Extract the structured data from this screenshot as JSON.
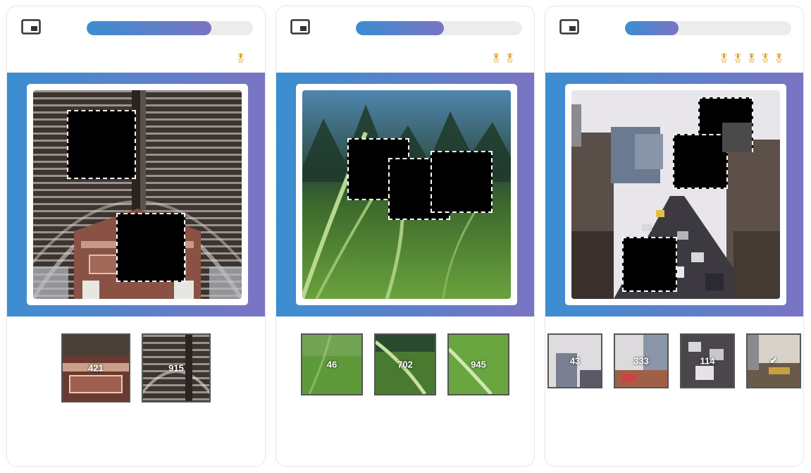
{
  "colors": {
    "accent_left": "#3b8ed0",
    "accent_right": "#7a74c4",
    "medal": "#d8a21a",
    "hole_border": "#ffffff"
  },
  "icons": {
    "picture_in_picture": "picture-in-picture-icon",
    "medal": "medal-icon",
    "check": "check-icon"
  },
  "cards": [
    {
      "progress": 0.75,
      "medal_count": 1,
      "image_subject": "steel roof structure",
      "tiles": [
        {
          "label": "421"
        },
        {
          "label": "915"
        }
      ]
    },
    {
      "progress": 0.53,
      "medal_count": 2,
      "image_subject": "grass field",
      "tiles": [
        {
          "label": "46"
        },
        {
          "label": "702"
        },
        {
          "label": "945"
        }
      ]
    },
    {
      "progress": 0.32,
      "medal_count": 5,
      "image_subject": "city street",
      "tiles": [
        {
          "label": "43"
        },
        {
          "label": "333"
        },
        {
          "label": "114"
        },
        {
          "label": "✔"
        }
      ]
    }
  ]
}
